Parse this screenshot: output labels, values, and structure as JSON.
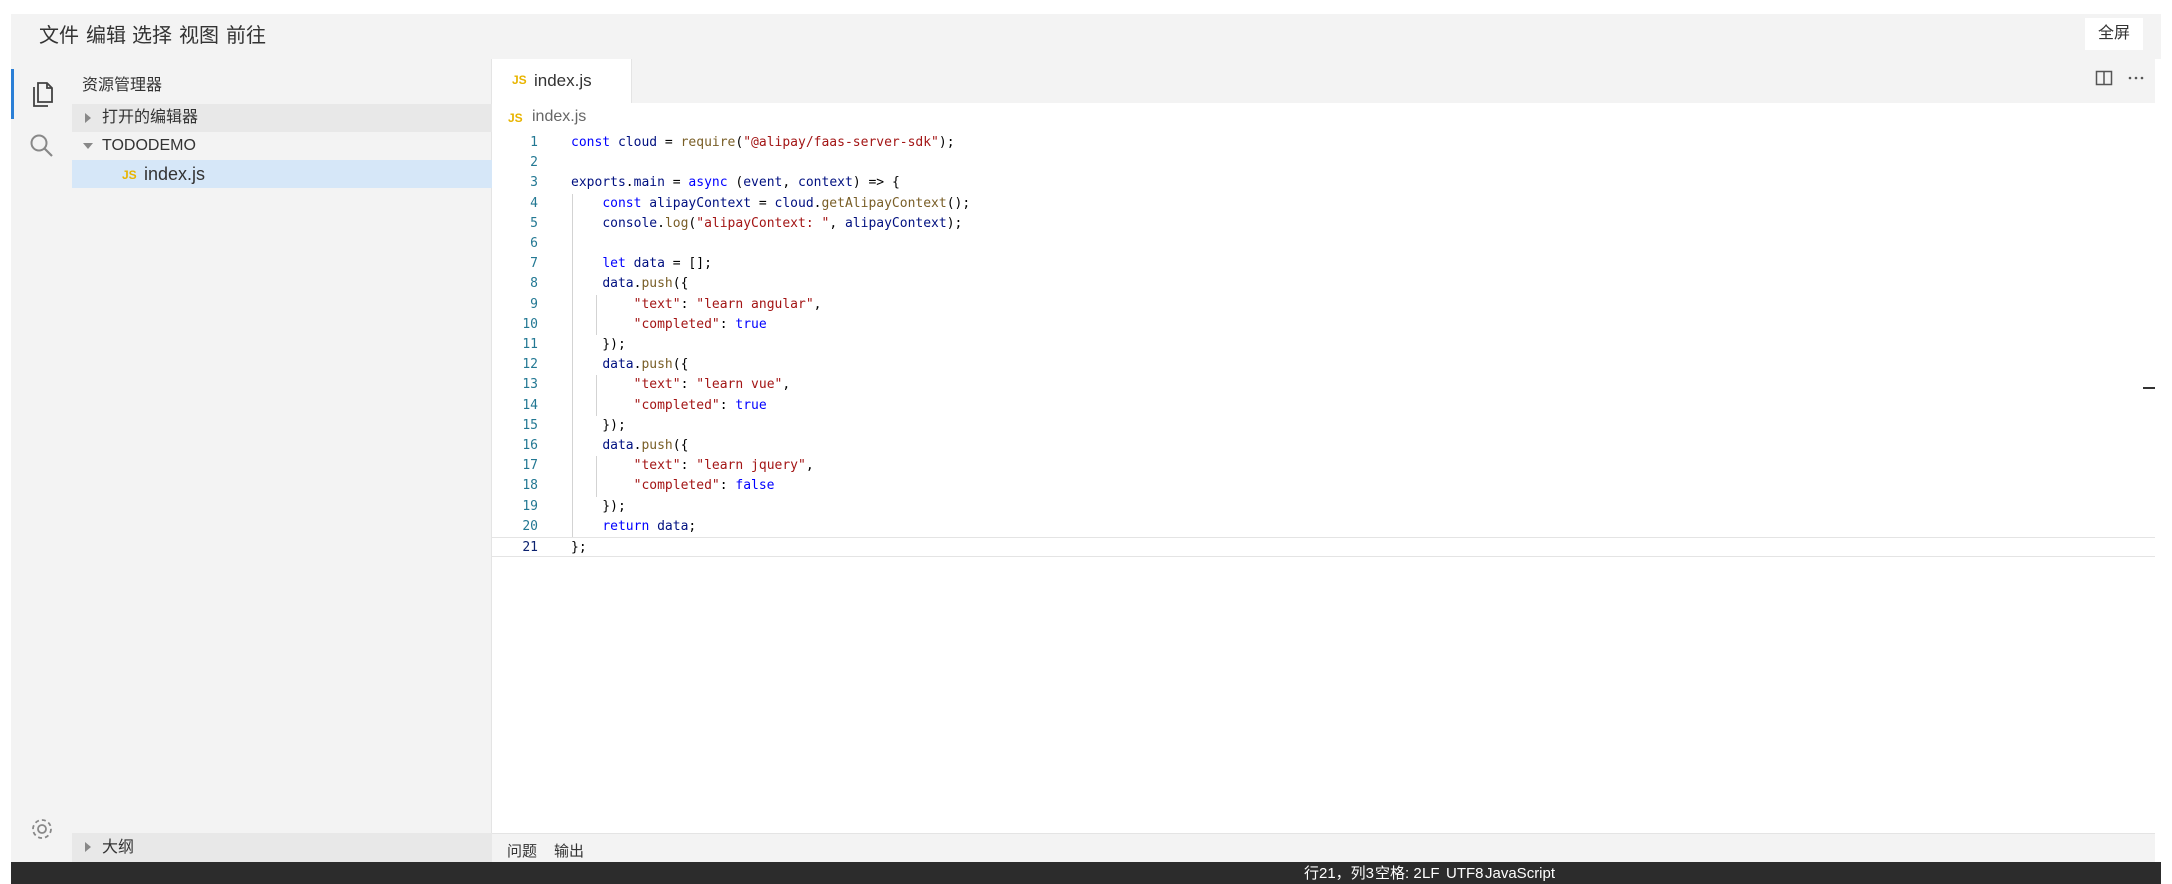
{
  "menubar": {
    "items": [
      "文件",
      "编辑",
      "选择",
      "视图",
      "前往"
    ],
    "fullscreen_label": "全屏"
  },
  "activitybar": {
    "icons": [
      "explorer-icon",
      "search-icon",
      "gear-icon"
    ]
  },
  "sidebar": {
    "title": "资源管理器",
    "open_editors_label": "打开的编辑器",
    "folder_label": "TODODEMO",
    "file_label": "index.js",
    "file_badge": "JS",
    "outline_label": "大纲"
  },
  "editor": {
    "tab_label": "index.js",
    "tab_badge": "JS",
    "breadcrumb_label": "index.js",
    "breadcrumb_badge": "JS",
    "lines": [
      "const cloud = require(\"@alipay/faas-server-sdk\");",
      "",
      "exports.main = async (event, context) => {",
      "    const alipayContext = cloud.getAlipayContext();",
      "    console.log(\"alipayContext: \", alipayContext);",
      "",
      "    let data = [];",
      "    data.push({",
      "        \"text\": \"learn angular\",",
      "        \"completed\": true",
      "    });",
      "    data.push({",
      "        \"text\": \"learn vue\",",
      "        \"completed\": true",
      "    });",
      "    data.push({",
      "        \"text\": \"learn jquery\",",
      "        \"completed\": false",
      "    });",
      "    return data;",
      "};"
    ],
    "current_line": 21
  },
  "panel": {
    "tabs": [
      "问题",
      "输出"
    ]
  },
  "statusbar": {
    "position": "行21，列3",
    "indent": "空格: 2",
    "eol": "LF",
    "encoding": "UTF8",
    "language": "JavaScript"
  }
}
